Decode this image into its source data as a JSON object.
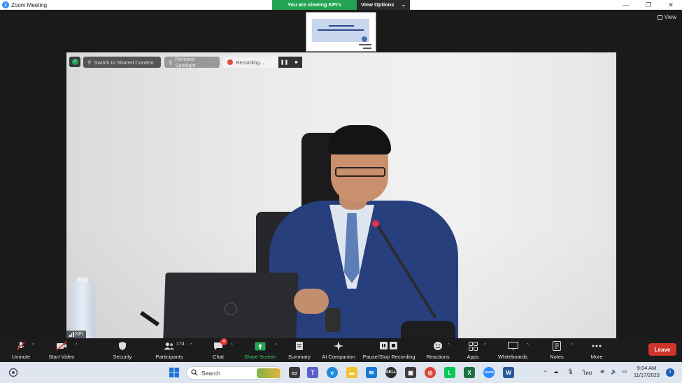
{
  "window": {
    "title": "Zoom Meeting",
    "banner_text": "You are viewing KPI's screen",
    "view_options": "View Options",
    "view_label": "View"
  },
  "overlay": {
    "switch_shared": "Switch to Shared Content",
    "remove_spotlight": "Remove Spotlight",
    "recording": "Recording..."
  },
  "participant": {
    "name": "KPI"
  },
  "toolbar": {
    "unmute": "Unmute",
    "start_video": "Start Video",
    "security": "Security",
    "participants": "Participants",
    "participants_count": "174",
    "chat": "Chat",
    "chat_badge": "4",
    "share_screen": "Share Screen",
    "summary": "Summary",
    "ai_companion": "AI Companion",
    "pause_stop_recording": "Pause/Stop Recording",
    "reactions": "Reactions",
    "apps": "Apps",
    "whiteboards": "Whiteboards",
    "notes": "Notes",
    "more": "More",
    "leave": "Leave"
  },
  "taskbar": {
    "search": "Search",
    "language": "ไทย",
    "time": "9:04 AM",
    "date": "11/17/2023",
    "notifications": "1"
  },
  "colors": {
    "accent_green": "#23a455",
    "leave_red": "#d0342c",
    "share_green": "#3ecf6a",
    "zoom_blue": "#2d8cff"
  }
}
